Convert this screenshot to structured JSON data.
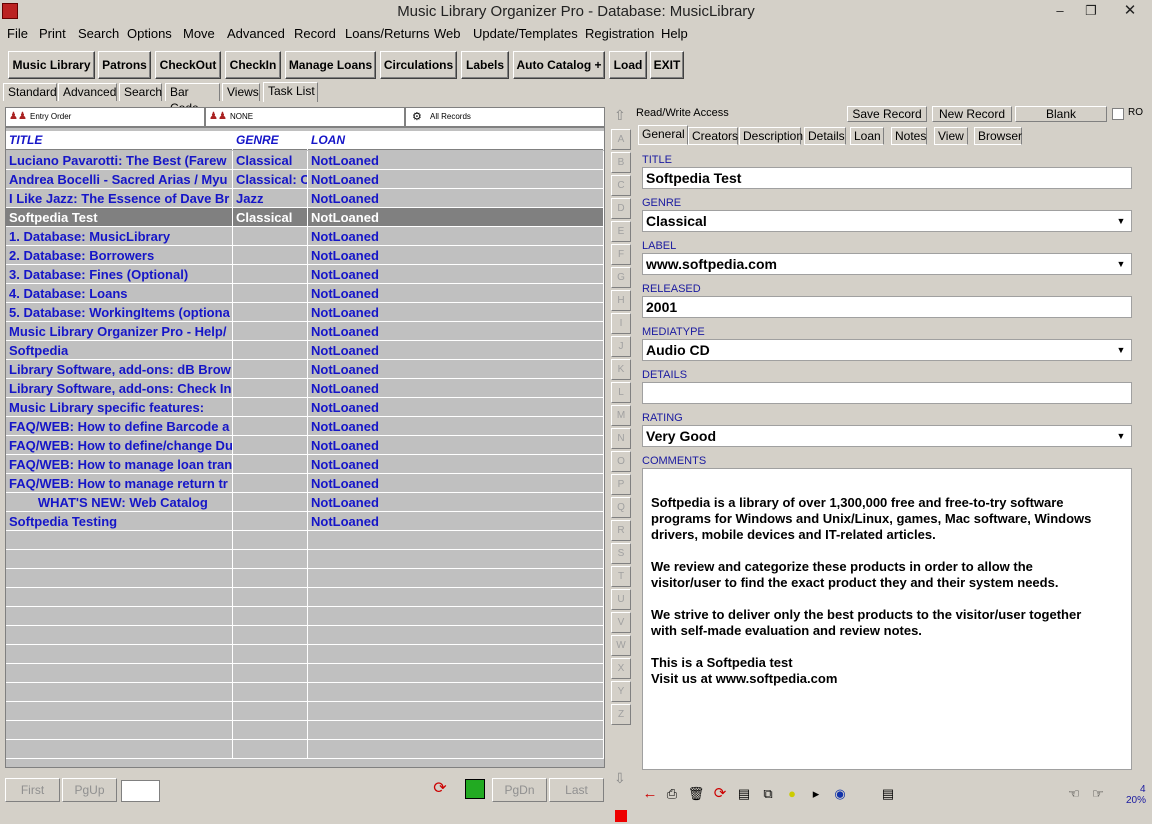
{
  "window": {
    "title": "Music Library Organizer Pro - Database: MusicLibrary"
  },
  "menu": [
    "File",
    "Print",
    "Search",
    "Options",
    "Move",
    "Advanced",
    "Record",
    "Loans/Returns",
    "Web",
    "Update/Templates",
    "Registration",
    "Help"
  ],
  "toolbar": [
    "Music Library",
    "Patrons",
    "CheckOut",
    "CheckIn",
    "Manage Loans",
    "Circulations",
    "Labels",
    "Auto Catalog +",
    "Load",
    "EXIT"
  ],
  "search_tabs": [
    "Standard",
    "Advanced",
    "Search",
    "Bar Code",
    "Views",
    "Task List"
  ],
  "grid_header_bar": {
    "order": "Entry Order",
    "filter": "NONE",
    "records": "All Records"
  },
  "grid": {
    "columns": [
      "TITLE",
      "GENRE",
      "LOAN"
    ],
    "rows": [
      [
        "Luciano Pavarotti: The Best (Farew",
        "Classical",
        "NotLoaned"
      ],
      [
        "Andrea Bocelli - Sacred Arias / Myu",
        "Classical: C",
        "NotLoaned"
      ],
      [
        "I Like Jazz: The Essence of Dave Br",
        "Jazz",
        "NotLoaned"
      ],
      [
        "Softpedia Test",
        "Classical",
        "NotLoaned"
      ],
      [
        "1. Database: MusicLibrary",
        "",
        "NotLoaned"
      ],
      [
        "2. Database: Borrowers",
        "",
        "NotLoaned"
      ],
      [
        "3. Database: Fines (Optional)",
        "",
        "NotLoaned"
      ],
      [
        "4. Database: Loans",
        "",
        "NotLoaned"
      ],
      [
        "5. Database: WorkingItems (optiona",
        "",
        "NotLoaned"
      ],
      [
        "Music Library Organizer Pro - Help/",
        "",
        "NotLoaned"
      ],
      [
        "Softpedia",
        "",
        "NotLoaned"
      ],
      [
        "Library Software, add-ons: dB Brow",
        "",
        "NotLoaned"
      ],
      [
        "Library Software, add-ons: Check In",
        "",
        "NotLoaned"
      ],
      [
        "Music Library specific features:",
        "",
        "NotLoaned"
      ],
      [
        "FAQ/WEB: How to define Barcode a",
        "",
        "NotLoaned"
      ],
      [
        "FAQ/WEB: How to define/change Du",
        "",
        "NotLoaned"
      ],
      [
        "FAQ/WEB: How to manage loan tran",
        "",
        "NotLoaned"
      ],
      [
        "FAQ/WEB: How to manage return tr",
        "",
        "NotLoaned"
      ],
      [
        "        WHAT'S NEW: Web Catalog",
        "",
        "NotLoaned"
      ],
      [
        "Softpedia Testing",
        "",
        "NotLoaned"
      ]
    ],
    "selected_index": 3
  },
  "alphabet": [
    "A",
    "B",
    "C",
    "D",
    "E",
    "F",
    "G",
    "H",
    "I",
    "J",
    "K",
    "L",
    "M",
    "N",
    "O",
    "P",
    "Q",
    "R",
    "S",
    "T",
    "U",
    "V",
    "W",
    "X",
    "Y",
    "Z"
  ],
  "nav": {
    "first": "First",
    "pgup": "PgUp",
    "pgdn": "PgDn",
    "last": "Last"
  },
  "record_bar": {
    "mode": "Read/Write Access",
    "save": "Save Record",
    "new": "New Record",
    "blank": "Blank",
    "ro": "RO"
  },
  "record_tabs": [
    "General",
    "Creators",
    "Description",
    "Details",
    "Loan",
    "Notes",
    "View",
    "Browser"
  ],
  "fields": {
    "title_label": "TITLE",
    "title": "Softpedia Test",
    "genre_label": "GENRE",
    "genre": "Classical",
    "label_label": "LABEL",
    "label": "www.softpedia.com",
    "released_label": "RELEASED",
    "released": "2001",
    "mediatype_label": "MEDIATYPE",
    "mediatype": "Audio CD",
    "details_label": "DETAILS",
    "details": "",
    "rating_label": "RATING",
    "rating": "Very Good",
    "comments_label": "COMMENTS",
    "comments": "Softpedia is a library of over 1,300,000 free and free-to-try software\nprograms for Windows and Unix/Linux, games, Mac software, Windows\ndrivers, mobile devices and IT-related articles.\n\nWe review and categorize these products in order to allow the\nvisitor/user to find the exact product they and their system needs.\n\nWe strive to deliver only the best products to the visitor/user together\nwith self-made evaluation and review notes.\n\nThis is a Softpedia test\n Visit us at www.softpedia.com"
  },
  "status": {
    "count": "4",
    "zoom": "20%"
  }
}
